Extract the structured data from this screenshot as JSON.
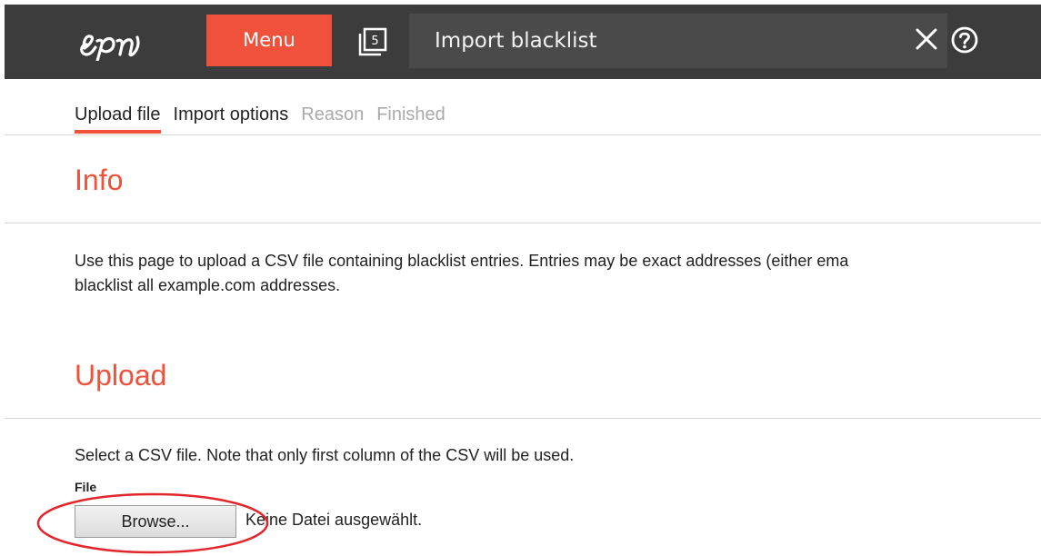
{
  "header": {
    "logo_text": "epi",
    "menu_label": "Menu",
    "pages_badge": "5",
    "title": "Import blacklist",
    "icons": {
      "pages": "pages-icon",
      "close": "close-icon",
      "help": "help-icon"
    }
  },
  "tabs": [
    {
      "label": "Upload file",
      "state": "active"
    },
    {
      "label": "Import options",
      "state": "enabled"
    },
    {
      "label": "Reason",
      "state": "disabled"
    },
    {
      "label": "Finished",
      "state": "disabled"
    }
  ],
  "info": {
    "title": "Info",
    "line1": "Use this page to upload a CSV file containing blacklist entries. Entries may be exact addresses (either ema",
    "line2": "blacklist all example.com addresses."
  },
  "upload": {
    "title": "Upload",
    "description": "Select a CSV file. Note that only first column of the CSV will be used.",
    "file_label": "File",
    "browse_label": "Browse...",
    "file_status": "Keine Datei ausgewählt."
  },
  "colors": {
    "accent": "#f0513a",
    "header_bg": "#3c3c3c",
    "title_box_bg": "#4a4a4a",
    "annotation": "#e3262b"
  }
}
